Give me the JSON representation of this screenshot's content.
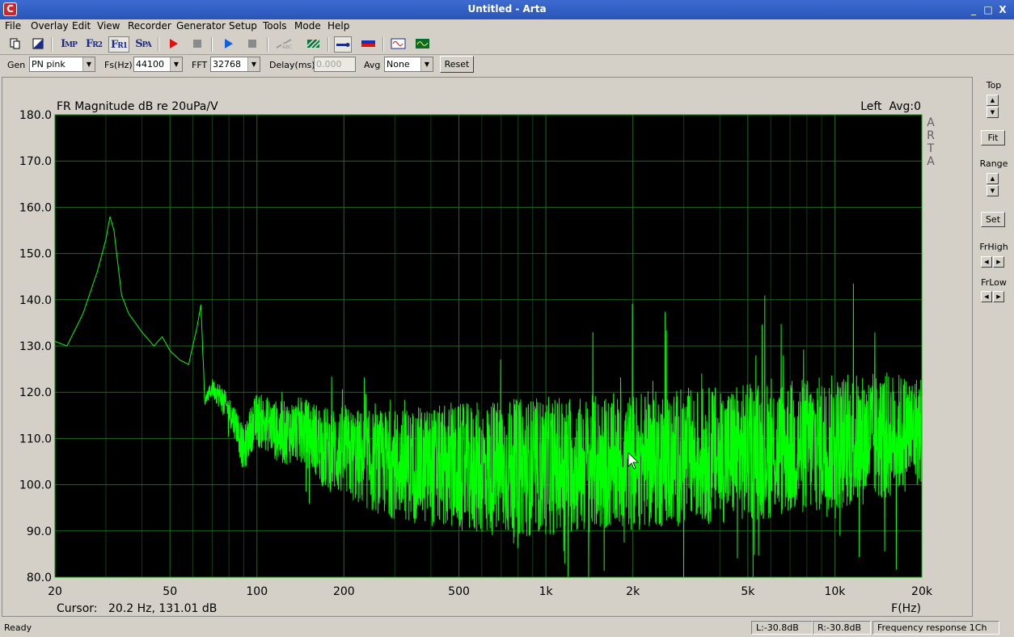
{
  "window": {
    "title": "Untitled - Arta",
    "icon": "arta-logo-icon",
    "minimize": "_",
    "maximize": "□",
    "close": "X"
  },
  "menu": [
    "File",
    "Overlay",
    "Edit",
    "View",
    "Recorder",
    "Generator",
    "Setup",
    "Tools",
    "Mode",
    "Help"
  ],
  "toolbar": {
    "buttons": [
      "new-document-icon",
      "open-icon",
      "IMP",
      "FR2",
      "FR1",
      "SPA",
      "record-icon",
      "stop-icon",
      "play-icon",
      "stop-icon",
      "abc-icon",
      "hatch-icon",
      "probe-icon",
      "level-icon",
      "sine-icon",
      "scope-icon"
    ],
    "imp_label": "I",
    "imp_sub": "MP",
    "fr2_label": "F",
    "fr2_sub": "R2",
    "fr1_label": "F",
    "fr1_sub": "R1",
    "spa_label": "S",
    "spa_sub": "PA"
  },
  "controls": {
    "gen_label": "Gen",
    "gen_value": "PN pink",
    "fs_label": "Fs(Hz)",
    "fs_value": "44100",
    "fft_label": "FFT",
    "fft_value": "32768",
    "delay_label": "Delay(ms)",
    "delay_value": "0.000",
    "avg_label": "Avg",
    "avg_value": "None",
    "reset_label": "Reset"
  },
  "right_panel": {
    "top_label": "Top",
    "fit_label": "Fit",
    "range_label": "Range",
    "set_label": "Set",
    "frhigh_label": "FrHigh",
    "frlow_label": "FrLow"
  },
  "plot": {
    "title": "FR Magnitude dB re 20uPa/V",
    "channel_info": "Left  Avg:0",
    "brand_letters": [
      "A",
      "R",
      "T",
      "A"
    ],
    "cursor_label": "Cursor:",
    "cursor_value": "20.2 Hz, 131.01 dB",
    "xaxis_label": "F(Hz)",
    "colors": {
      "background": "#000000",
      "grid": "#1a5c1a",
      "trace": "#00ff00",
      "axis": "#00c000"
    }
  },
  "chart_data": {
    "type": "line",
    "title": "FR Magnitude dB re 20uPa/V",
    "xlabel": "F(Hz)",
    "ylabel": "",
    "xscale": "log",
    "xlim": [
      20,
      20000
    ],
    "ylim": [
      80,
      180
    ],
    "grid": true,
    "xticks": [
      {
        "v": 20,
        "label": "20"
      },
      {
        "v": 50,
        "label": "50"
      },
      {
        "v": 100,
        "label": "100"
      },
      {
        "v": 200,
        "label": "200"
      },
      {
        "v": 500,
        "label": "500"
      },
      {
        "v": 1000,
        "label": "1k"
      },
      {
        "v": 2000,
        "label": "2k"
      },
      {
        "v": 5000,
        "label": "5k"
      },
      {
        "v": 10000,
        "label": "10k"
      },
      {
        "v": 20000,
        "label": "20k"
      }
    ],
    "yticks": [
      "180.0",
      "170.0",
      "160.0",
      "150.0",
      "140.0",
      "130.0",
      "120.0",
      "110.0",
      "100.0",
      "90.0",
      "80.0"
    ],
    "series": [
      {
        "x": [
          20,
          22,
          25,
          28,
          30,
          31,
          32,
          34,
          36,
          40,
          44,
          47,
          50,
          54,
          58,
          62,
          64,
          66,
          70,
          75,
          80,
          85,
          90,
          95,
          100,
          110,
          120,
          140,
          160,
          170,
          200,
          250,
          300,
          400,
          500,
          700,
          1000,
          1500,
          2000,
          3000,
          5000,
          7000,
          10000,
          15000,
          20000
        ],
        "y": [
          131.0,
          130.0,
          137.0,
          146.0,
          153.0,
          158.0,
          155.0,
          141.0,
          137.0,
          133.0,
          130.0,
          132.0,
          129.0,
          127.0,
          126.0,
          134.0,
          139.0,
          118.0,
          121.0,
          119.0,
          116.0,
          113.0,
          107.0,
          112.0,
          114.0,
          113.0,
          111.0,
          112.0,
          110.0,
          108.0,
          107.0,
          105.0,
          104.5,
          104.0,
          103.5,
          103.5,
          104.0,
          104.5,
          105.0,
          106.0,
          107.0,
          108.0,
          109.0,
          110.5,
          112.0
        ],
        "spread": [
          0,
          0,
          0,
          0,
          0,
          0,
          0,
          0,
          0,
          0,
          0,
          0,
          0,
          0,
          0,
          0,
          0,
          1,
          2,
          3,
          3,
          4,
          5,
          5,
          6,
          6,
          7,
          7,
          8,
          9,
          10,
          11,
          12,
          13,
          14,
          15,
          15,
          15,
          15,
          15,
          15,
          15,
          15,
          14,
          12
        ]
      }
    ]
  },
  "status": {
    "ready": "Ready",
    "left_level": "L:-30.8dB",
    "right_level": "R:-30.8dB",
    "mode": "Frequency response 1Ch"
  }
}
